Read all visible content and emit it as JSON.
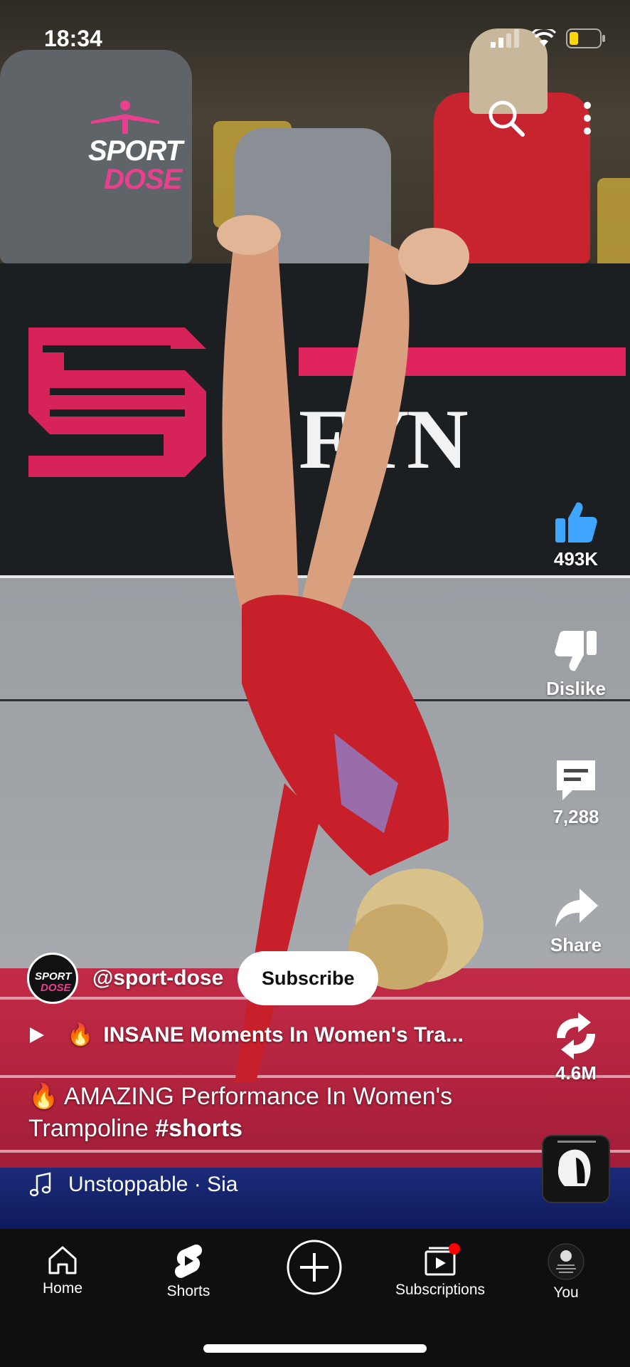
{
  "status_bar": {
    "time": "18:34"
  },
  "overlay": {
    "brand_line1": "SPORT",
    "brand_line2": "DOSE",
    "banner_text": "FYN"
  },
  "actions": {
    "like_count": "493K",
    "dislike_label": "Dislike",
    "comment_count": "7,288",
    "share_label": "Share",
    "remix_count": "4.6M"
  },
  "channel": {
    "avatar_line1": "SPORT",
    "avatar_line2": "DOSE",
    "handle": "@sport-dose",
    "subscribe_label": "Subscribe"
  },
  "related_video": {
    "emoji": "🔥",
    "title": "INSANE Moments In Women's Tra..."
  },
  "caption": {
    "emoji": "🔥",
    "text": "AMAZING Performance In Women's Trampoline",
    "hashtag": "#shorts"
  },
  "music": {
    "label": "Unstoppable · Sia"
  },
  "nav": {
    "items": [
      {
        "label": "Home",
        "icon": "home-icon"
      },
      {
        "label": "Shorts",
        "icon": "shorts-icon"
      },
      {
        "label": "",
        "icon": "create-icon"
      },
      {
        "label": "Subscriptions",
        "icon": "subscriptions-icon"
      },
      {
        "label": "You",
        "icon": "profile-avatar"
      }
    ]
  },
  "colors": {
    "like_blue": "#3ea6ff",
    "brand_pink": "#e7408f",
    "nav_bg": "#0f0f0f",
    "notification_red": "#ff0000"
  }
}
